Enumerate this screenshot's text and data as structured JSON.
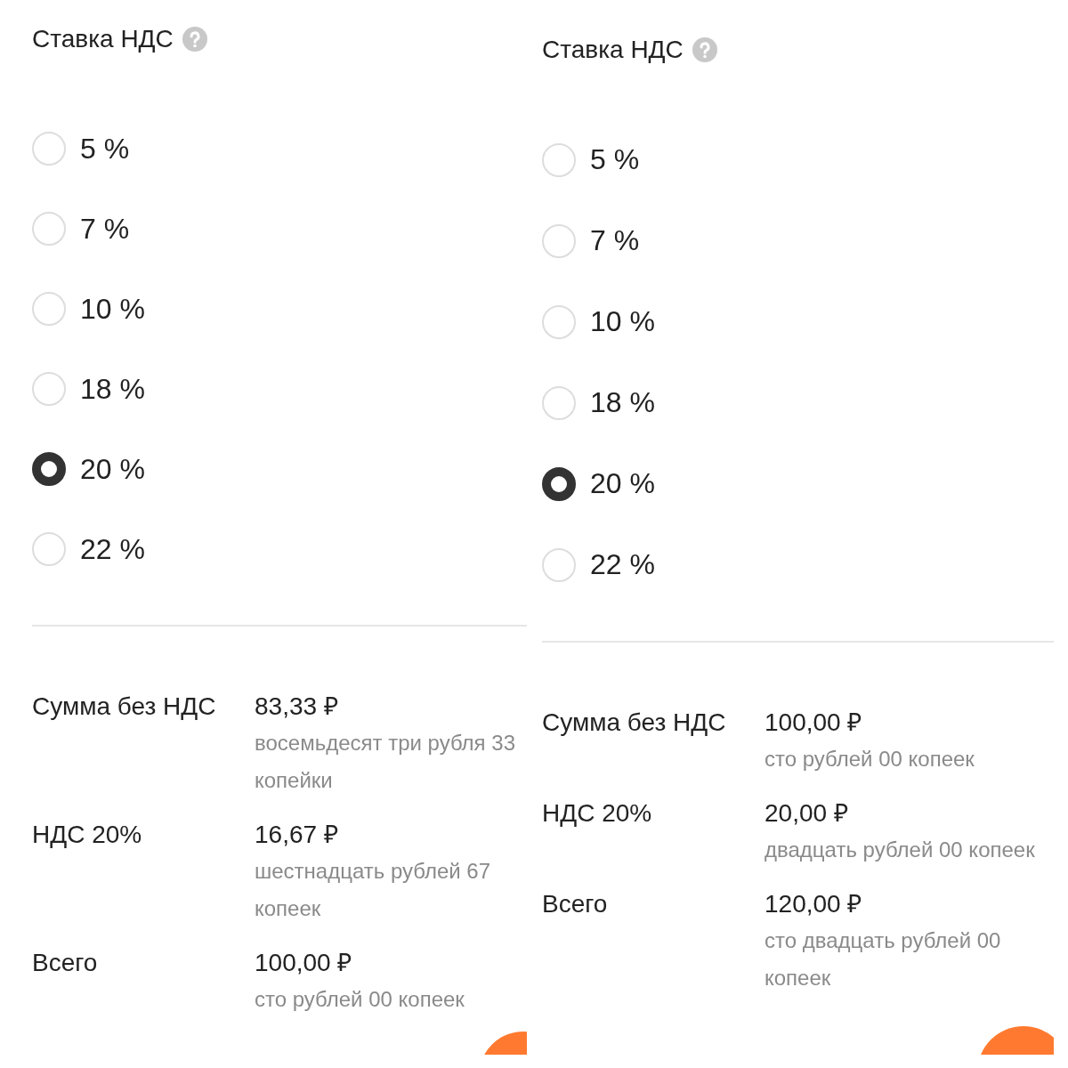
{
  "panels": [
    {
      "title": "Ставка НДС",
      "options": [
        {
          "label": "5 %",
          "selected": false
        },
        {
          "label": "7 %",
          "selected": false
        },
        {
          "label": "10 %",
          "selected": false
        },
        {
          "label": "18 %",
          "selected": false
        },
        {
          "label": "20 %",
          "selected": true
        },
        {
          "label": "22 %",
          "selected": false
        }
      ],
      "summary": [
        {
          "label": "Сумма без НДС",
          "amount": "83,33 ₽",
          "words": "восемьдесят три рубля 33 копейки"
        },
        {
          "label": "НДС 20%",
          "amount": "16,67 ₽",
          "words": "шестнадцать рублей 67 копеек"
        },
        {
          "label": "Всего",
          "amount": "100,00 ₽",
          "words": "сто рублей 00 копеек"
        }
      ]
    },
    {
      "title": "Ставка НДС",
      "options": [
        {
          "label": "5 %",
          "selected": false
        },
        {
          "label": "7 %",
          "selected": false
        },
        {
          "label": "10 %",
          "selected": false
        },
        {
          "label": "18 %",
          "selected": false
        },
        {
          "label": "20 %",
          "selected": true
        },
        {
          "label": "22 %",
          "selected": false
        }
      ],
      "summary": [
        {
          "label": "Сумма без НДС",
          "amount": "100,00 ₽",
          "words": "сто рублей 00 копеек"
        },
        {
          "label": "НДС 20%",
          "amount": "20,00 ₽",
          "words": "двадцать рублей 00 копеек"
        },
        {
          "label": "Всего",
          "amount": "120,00 ₽",
          "words": "сто двадцать рублей 00 копеек"
        }
      ]
    }
  ]
}
